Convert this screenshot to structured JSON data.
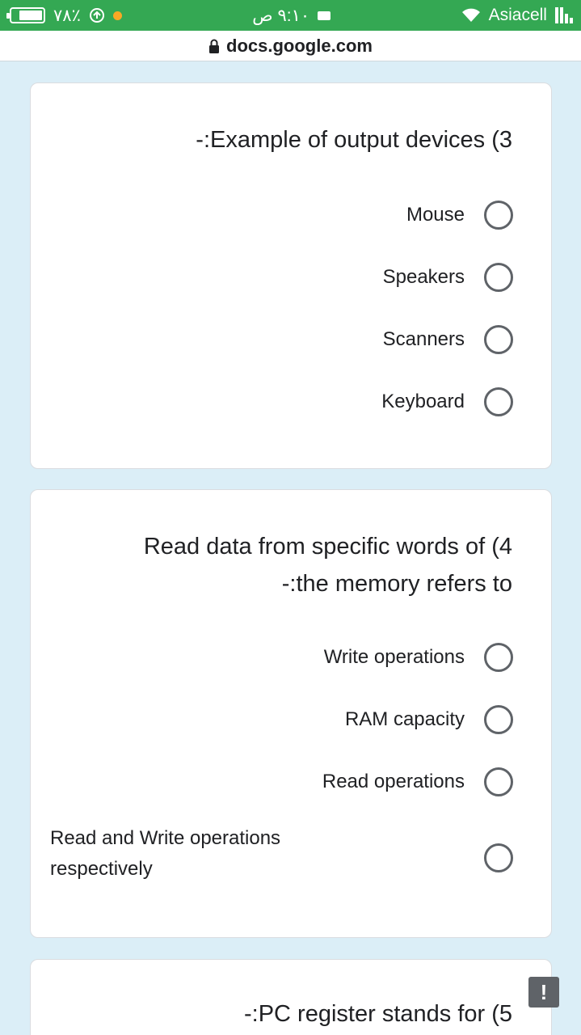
{
  "status_bar": {
    "battery_text": "٧٨٪",
    "time": "٩:١٠ ص",
    "carrier": "Asiacell"
  },
  "address_bar": {
    "url": "docs.google.com"
  },
  "questions": [
    {
      "title": "-:Example of output devices (3",
      "options": [
        "Mouse",
        "Speakers",
        "Scanners",
        "Keyboard"
      ]
    },
    {
      "title_line1": "Read data from specific words of (4",
      "title_line2": "-:the memory refers to",
      "options": [
        "Write operations",
        "RAM capacity",
        "Read operations",
        "Read and Write operations respectively"
      ]
    },
    {
      "title": "-:PC register stands for (5"
    }
  ],
  "colors": {
    "status_bar": "#34a853",
    "background": "#dbeef7",
    "radio_border": "#5f6368"
  },
  "icons": [
    "lock-icon",
    "wifi-icon",
    "signal-icon",
    "battery-icon",
    "report-icon"
  ],
  "badge_text": "!"
}
